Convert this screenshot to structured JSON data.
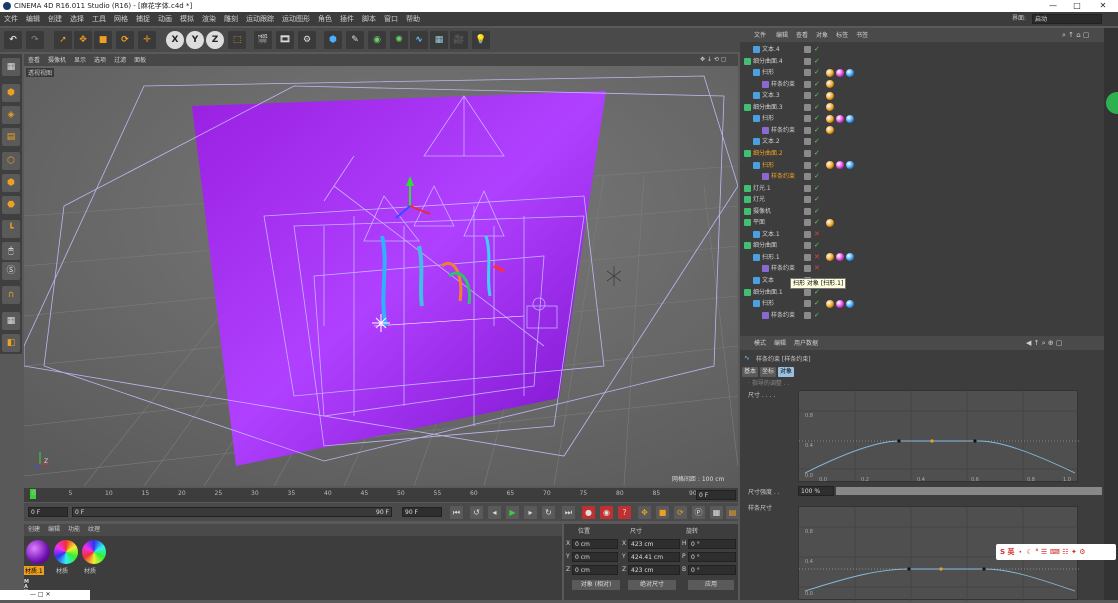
{
  "window": {
    "title": "CINEMA 4D R16.011 Studio (R16) - [麻花字体.c4d *]",
    "min": "—",
    "max": "□",
    "close": "✕"
  },
  "menu": [
    "文件",
    "编辑",
    "创建",
    "选择",
    "工具",
    "网格",
    "捕捉",
    "动画",
    "模拟",
    "渲染",
    "雕刻",
    "运动跟踪",
    "运动图形",
    "角色",
    "插件",
    "脚本",
    "窗口",
    "帮助"
  ],
  "layout": {
    "label": "界面:",
    "value": "启动"
  },
  "viewport": {
    "menu": [
      "查看",
      "摄像机",
      "显示",
      "选项",
      "过滤",
      "面板"
    ],
    "label": "透视视图",
    "grid_label": "网格间距 : 100 cm",
    "nav_icons": "✥ ↓ ⟲ ▢",
    "axis_z": "Z"
  },
  "timeline": {
    "ticks": [
      "0",
      "5",
      "10",
      "15",
      "20",
      "25",
      "30",
      "35",
      "40",
      "45",
      "50",
      "55",
      "60",
      "65",
      "70",
      "75",
      "80",
      "85",
      "90"
    ],
    "end_field": "0 F",
    "start_field": "0 F",
    "range_label": "0 F",
    "range_end": "90 F",
    "range_end_field": "90 F"
  },
  "materials": {
    "menu": [
      "创建",
      "编辑",
      "功能",
      "纹理"
    ],
    "items": [
      {
        "name": "材质.1"
      },
      {
        "name": "材质"
      },
      {
        "name": "材质"
      }
    ]
  },
  "coords": {
    "headers": {
      "pos": "位置",
      "size": "尺寸",
      "rot": "旋转"
    },
    "rows": [
      {
        "axis": "X",
        "pos": "0 cm",
        "saxis": "X",
        "size": "423 cm",
        "raxis": "H",
        "rot": "0 °"
      },
      {
        "axis": "Y",
        "pos": "0 cm",
        "saxis": "Y",
        "size": "424.41 cm",
        "raxis": "P",
        "rot": "0 °"
      },
      {
        "axis": "Z",
        "pos": "0 cm",
        "saxis": "Z",
        "size": "423 cm",
        "raxis": "B",
        "rot": "0 °"
      }
    ],
    "mode": "对象 (相对)",
    "size_mode": "绝对尺寸",
    "apply": "应用"
  },
  "objects": {
    "menu": [
      "文件",
      "编辑",
      "查看",
      "对象",
      "标签",
      "书签"
    ],
    "rows": [
      {
        "indent": 1,
        "name": "文本.4",
        "check": "✓",
        "tags": 0
      },
      {
        "indent": 0,
        "name": "细分曲面.4",
        "check": "✓",
        "tags": 0
      },
      {
        "indent": 1,
        "name": "扫形",
        "check": "✓",
        "tags": 3
      },
      {
        "indent": 2,
        "name": "样条约束",
        "check": "✓",
        "tags": 1
      },
      {
        "indent": 1,
        "name": "文本.3",
        "check": "✓",
        "tags": 1
      },
      {
        "indent": 0,
        "name": "细分曲面.3",
        "check": "✓",
        "tags": 1
      },
      {
        "indent": 1,
        "name": "扫形",
        "check": "✓",
        "tags": 3
      },
      {
        "indent": 2,
        "name": "样条约束",
        "check": "✓",
        "tags": 1
      },
      {
        "indent": 1,
        "name": "文本.2",
        "check": "✓",
        "tags": 0
      },
      {
        "indent": 0,
        "name": "细分曲面.2",
        "check": "✓",
        "tags": 0,
        "hl": true
      },
      {
        "indent": 1,
        "name": "扫形",
        "check": "✓",
        "tags": 3,
        "hl": true
      },
      {
        "indent": 2,
        "name": "样条约束",
        "check": "✓",
        "tags": 0,
        "hl": true
      },
      {
        "indent": 0,
        "name": "灯光.1",
        "check": "✓",
        "tags": 0
      },
      {
        "indent": 0,
        "name": "灯光",
        "check": "✓",
        "tags": 0
      },
      {
        "indent": 0,
        "name": "摄像机",
        "check": "✓",
        "tags": 0
      },
      {
        "indent": 0,
        "name": "平面",
        "check": "✓",
        "tags": 1
      },
      {
        "indent": 1,
        "name": "文本.1",
        "check": "✕",
        "tags": 0,
        "red": true
      },
      {
        "indent": 0,
        "name": "细分曲面",
        "check": "✓",
        "tags": 0
      },
      {
        "indent": 1,
        "name": "扫形.1",
        "check": "✕",
        "tags": 3,
        "red": true
      },
      {
        "indent": 2,
        "name": "样条约束",
        "check": "✕",
        "tags": 0,
        "red": true
      },
      {
        "indent": 1,
        "name": "文本",
        "check": "✓",
        "tags": 0
      },
      {
        "indent": 0,
        "name": "细分曲面.1",
        "check": "✓",
        "tags": 0
      },
      {
        "indent": 1,
        "name": "扫形",
        "check": "✓",
        "tags": 3
      },
      {
        "indent": 2,
        "name": "样条约束",
        "check": "✓",
        "tags": 0
      }
    ],
    "tooltip": "扫形 对象 [扫形.1]"
  },
  "attributes": {
    "menu": [
      "模式",
      "编辑",
      "用户数据"
    ],
    "title": "样条约束 [样条约束]",
    "tabs": [
      "基本",
      "坐标",
      "对象"
    ],
    "sub": "· 指导的调整 . .",
    "size_label": "尺寸 . . . .",
    "strength_label": "尺寸强度 . .",
    "strength_value": "100 %",
    "spline_size_label": "样条尺寸",
    "graph_y": [
      "0.8",
      "0.4",
      "0.0"
    ],
    "graph_x": [
      "0.0",
      "0.2",
      "0.4",
      "0.6",
      "0.8",
      "1.0"
    ],
    "graph2_y": [
      "0.8",
      "0.4",
      "0.0"
    ]
  },
  "ime": {
    "text": "S 英 ・ ☾ ° ☰ ⌨ ☷ ✦ ⚙"
  },
  "taskbar": {
    "text": "— □ ✕"
  }
}
